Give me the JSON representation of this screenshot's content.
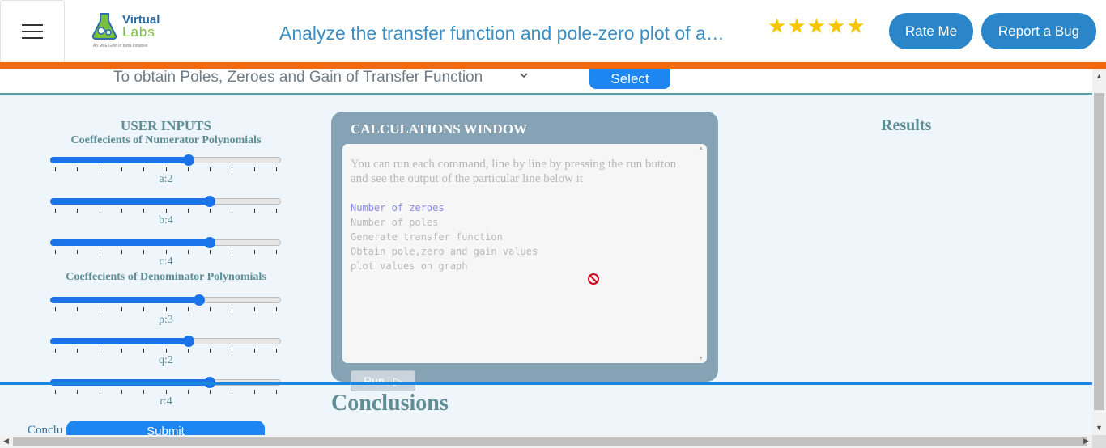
{
  "header": {
    "logo": {
      "line1": "Virtual",
      "line2": "Labs",
      "tagline": "An MoE Govt of India Initiative"
    },
    "title": "Analyze the transfer function and pole-zero plot of a…",
    "stars": [
      "★",
      "★",
      "★",
      "★",
      "★"
    ],
    "rate_label": "Rate Me",
    "bug_label": "Report a Bug"
  },
  "selector": {
    "value": "To obtain Poles, Zeroes and Gain of Transfer Function",
    "button_label": "Select"
  },
  "inputs": {
    "title": "USER INPUTS",
    "numerator_title": "Coeffecients of Numerator Polynomials",
    "denominator_title": "Coeffecients of Denominator Polynomials",
    "sliders": [
      {
        "label": "a:2",
        "fraction": 0.6
      },
      {
        "label": "b:4",
        "fraction": 0.69
      },
      {
        "label": "c:4",
        "fraction": 0.69
      },
      {
        "label": "p:3",
        "fraction": 0.645
      },
      {
        "label": "q:2",
        "fraction": 0.6
      },
      {
        "label": "r:4",
        "fraction": 0.69
      }
    ]
  },
  "calc": {
    "title": "CALCULATIONS WINDOW",
    "hint": "You can run each command, line by line by pressing the run button and see the output of the particular line below it",
    "commands": [
      "Number of zeroes",
      "Number of poles",
      "Generate transfer function",
      "Obtain pole,zero and gain values",
      "plot values on graph"
    ],
    "active_index": 0,
    "run_label": "Run | ▷"
  },
  "results": {
    "title": "Results"
  },
  "conclusions": {
    "title": "Conclusions",
    "label": "Conclu",
    "submit_label": "Submit"
  },
  "colors": {
    "accent_orange": "#f0690f",
    "accent_blue": "#1d86f0",
    "heading_teal": "#5e8d95",
    "star_gold": "#f7c600"
  }
}
